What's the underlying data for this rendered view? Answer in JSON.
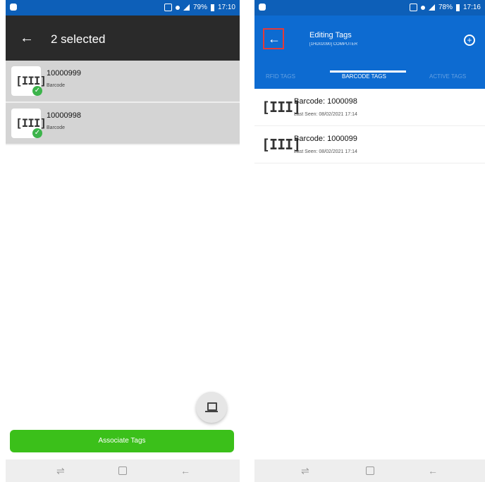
{
  "left_screen": {
    "title": "2 selected",
    "back_icon": "arrow-left-icon",
    "items": [
      {
        "number": "10000999",
        "type": "Barcode",
        "icon": "barcode-icon",
        "selected_icon": "check-icon"
      },
      {
        "number": "10000998",
        "type": "Barcode",
        "icon": "barcode-icon",
        "selected_icon": "check-icon"
      }
    ],
    "fab_icon": "laptop-icon",
    "associate_button": "Associate Tags"
  },
  "right_screen": {
    "title": "Editing Tags",
    "subtitle": "[1HD02090] COMPUTER",
    "back_icon": "arrow-left-icon",
    "add_icon": "plus-circle-icon",
    "tabs": [
      {
        "label": "RFID TAGS",
        "active": false
      },
      {
        "label": "BARCODE TAGS",
        "active": true
      },
      {
        "label": "ACTIVE TAGS",
        "active": false
      }
    ],
    "tags": [
      {
        "name": "Barcode: 1000098",
        "last_seen": "Last Seen: 08/02/2021 17:14",
        "icon": "barcode-icon"
      },
      {
        "name": "Barcode: 1000099",
        "last_seen": "Last Seen: 08/02/2021 17:14",
        "icon": "barcode-icon"
      }
    ]
  },
  "status_bar": {
    "left_battery": "79%",
    "left_time": "17:10",
    "right_battery": "78%",
    "right_time": "17:16"
  },
  "nav_bar": {
    "recents_icon": "recents-icon",
    "home_icon": "home-icon",
    "back_icon": "back-icon"
  },
  "colors": {
    "status_bar": "#0d5fb8",
    "app_bar_dark": "#2a2a2a",
    "app_bar_blue": "#0d6bd1",
    "selected_row": "#d4d4d4",
    "accent_green": "#3bc01a",
    "highlight_red": "#e23a3a"
  }
}
